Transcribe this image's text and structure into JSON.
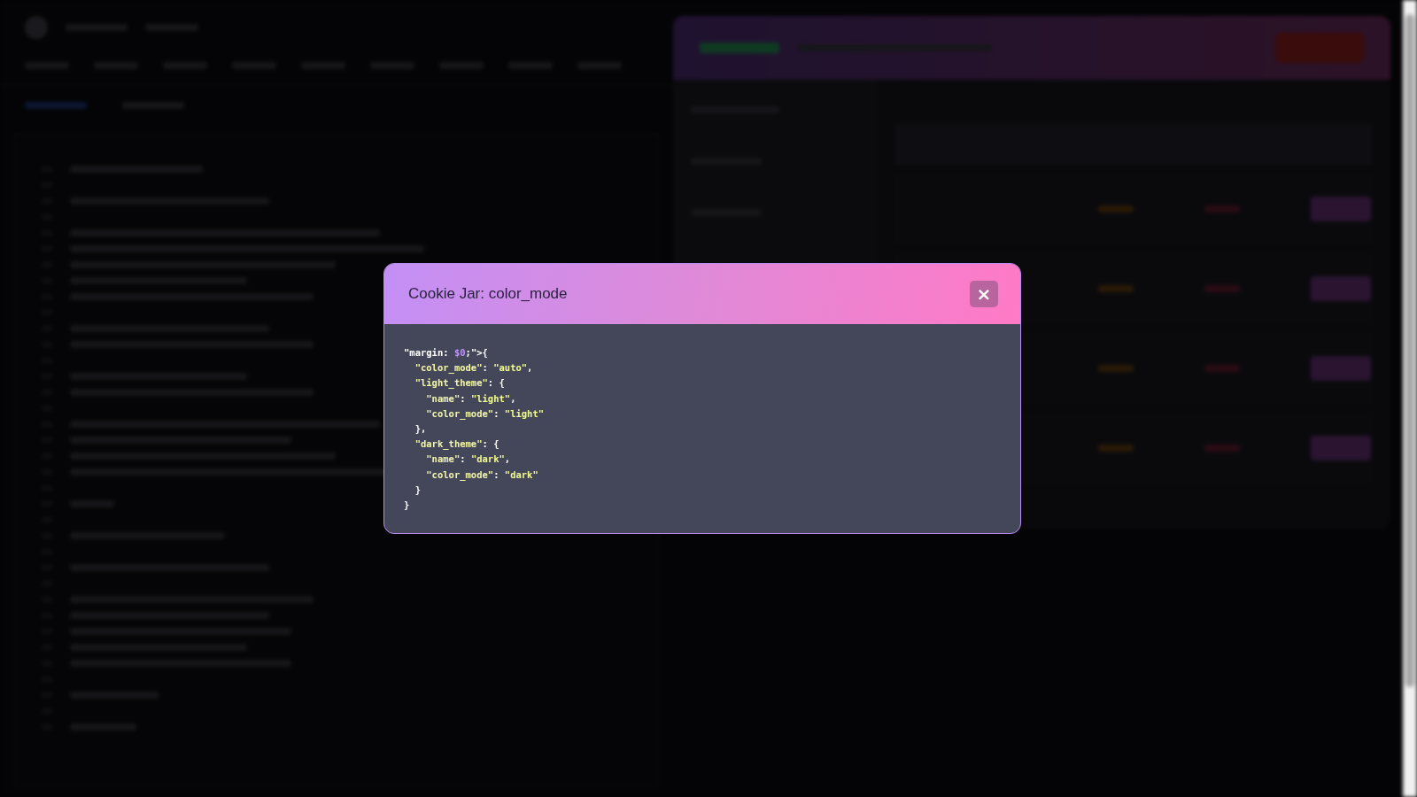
{
  "modal": {
    "title": "Cookie Jar: color_mode",
    "close_label": "×",
    "code_lines": [
      [
        {
          "kind": "plain",
          "text": "\"margin: "
        },
        {
          "kind": "var",
          "text": "$0"
        },
        {
          "kind": "plain",
          "text": ";\">{"
        }
      ],
      [
        {
          "kind": "key",
          "text": "  \"color_mode\""
        },
        {
          "kind": "plain",
          "text": ": "
        },
        {
          "kind": "string",
          "text": "\"auto\""
        },
        {
          "kind": "plain",
          "text": ","
        }
      ],
      [
        {
          "kind": "key",
          "text": "  \"light_theme\""
        },
        {
          "kind": "plain",
          "text": ": {"
        }
      ],
      [
        {
          "kind": "key",
          "text": "    \"name\""
        },
        {
          "kind": "plain",
          "text": ": "
        },
        {
          "kind": "string",
          "text": "\"light\""
        },
        {
          "kind": "plain",
          "text": ","
        }
      ],
      [
        {
          "kind": "key",
          "text": "    \"color_mode\""
        },
        {
          "kind": "plain",
          "text": ": "
        },
        {
          "kind": "string",
          "text": "\"light\""
        }
      ],
      [
        {
          "kind": "plain",
          "text": "  },"
        }
      ],
      [
        {
          "kind": "key",
          "text": "  \"dark_theme\""
        },
        {
          "kind": "plain",
          "text": ": {"
        }
      ],
      [
        {
          "kind": "key",
          "text": "    \"name\""
        },
        {
          "kind": "plain",
          "text": ": "
        },
        {
          "kind": "string",
          "text": "\"dark\""
        },
        {
          "kind": "plain",
          "text": ","
        }
      ],
      [
        {
          "kind": "key",
          "text": "    \"color_mode\""
        },
        {
          "kind": "plain",
          "text": ": "
        },
        {
          "kind": "string",
          "text": "\"dark\""
        }
      ],
      [
        {
          "kind": "plain",
          "text": "  }"
        }
      ],
      [
        {
          "kind": "plain",
          "text": "}"
        }
      ]
    ]
  }
}
